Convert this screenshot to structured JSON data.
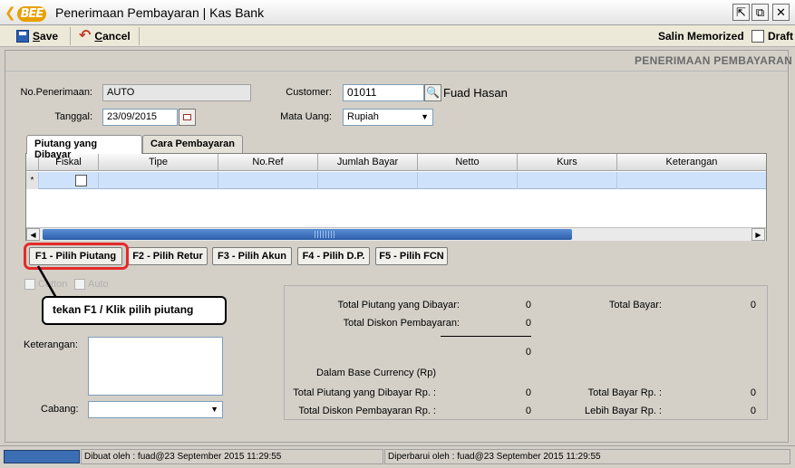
{
  "window": {
    "logo_text": "BEE",
    "title": "Penerimaan Pembayaran | Kas Bank",
    "btn_restore": "⇱",
    "btn_float": "⧉",
    "btn_close": "✕"
  },
  "toolbar": {
    "save_key": "S",
    "save_rest": "ave",
    "cancel_key": "C",
    "cancel_rest": "ancel",
    "salin_memorized": "Salin Memorized",
    "draft": "Draft"
  },
  "header": {
    "section_title": "PENERIMAAN PEMBAYARAN"
  },
  "form": {
    "no_penerimaan_label": "No.Penerimaan:",
    "no_penerimaan_value": "AUTO",
    "tanggal_label": "Tanggal:",
    "tanggal_value": "23/09/2015",
    "customer_label": "Customer:",
    "customer_code": "01011",
    "customer_name": "Fuad Hasan",
    "mata_uang_label": "Mata Uang:",
    "mata_uang_value": "Rupiah"
  },
  "tabs": [
    {
      "label": "Piutang yang Dibayar",
      "active": true
    },
    {
      "label": "Cara Pembayaran",
      "active": false
    }
  ],
  "grid": {
    "row_marker": "*",
    "columns": [
      "Fiskal",
      "Tipe",
      "No.Ref",
      "Jumlah Bayar",
      "Netto",
      "Kurs",
      "Keterangan"
    ]
  },
  "fbuttons": [
    {
      "label": "F1 - Pilih Piutang"
    },
    {
      "label": "F2 - Pilih Retur"
    },
    {
      "label": "F3 - Pilih Akun"
    },
    {
      "label": "F4 - Pilih D.P."
    },
    {
      "label": "F5 - Pilih FCN"
    }
  ],
  "options": {
    "cotton": "Cotton",
    "auto": "Auto"
  },
  "callout": "tekan F1 / Klik pilih piutang",
  "keterangan_label": "Keterangan:",
  "keterangan_value": "",
  "cabang_label": "Cabang:",
  "cabang_value": "",
  "summary": {
    "total_piutang_label": "Total Piutang yang Dibayar:",
    "total_piutang_value": "0",
    "total_diskon_label": "Total Diskon Pembayaran:",
    "total_diskon_value": "0",
    "subtotal_value": "0",
    "total_bayar_label": "Total Bayar:",
    "total_bayar_value": "0",
    "base_currency_label": "Dalam Base Currency (Rp)",
    "total_piutang_rp_label": "Total Piutang yang Dibayar Rp. :",
    "total_piutang_rp_value": "0",
    "total_diskon_rp_label": "Total Diskon Pembayaran Rp. :",
    "total_diskon_rp_value": "0",
    "total_bayar_rp_label": "Total Bayar Rp. :",
    "total_bayar_rp_value": "0",
    "lebih_bayar_rp_label": "Lebih Bayar Rp. :",
    "lebih_bayar_rp_value": "0"
  },
  "status": {
    "dibuat": "Dibuat oleh : fuad@23 September 2015  11:29:55",
    "diperbarui": "Diperbarui oleh : fuad@23 September 2015  11:29:55"
  }
}
